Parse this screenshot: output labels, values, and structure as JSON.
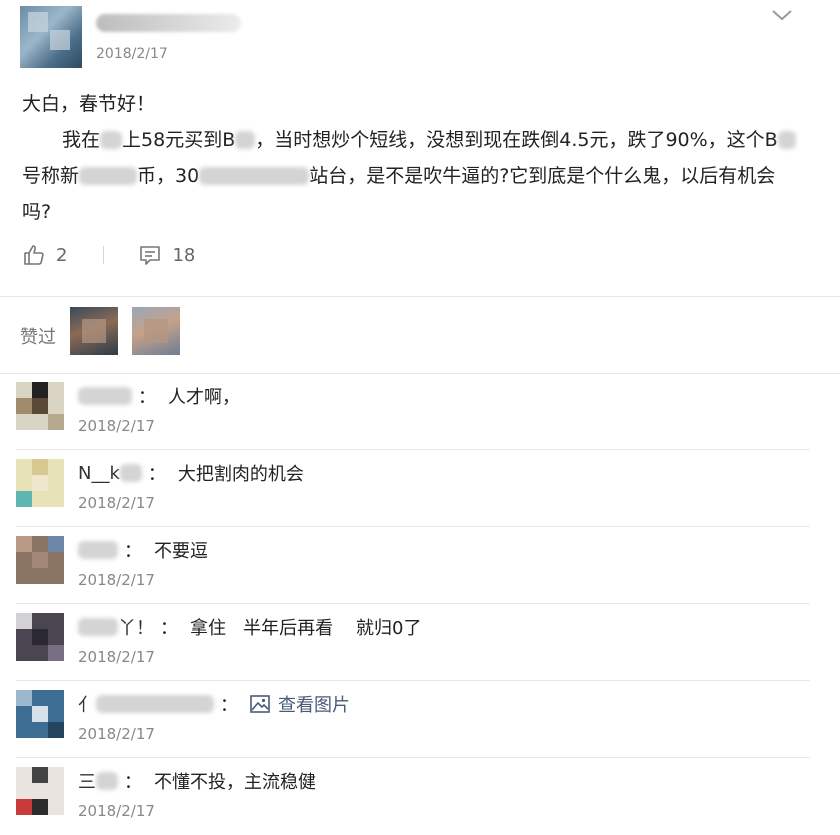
{
  "post": {
    "date": "2018/2/17",
    "greeting": "大白，春节好！",
    "body_part1": "我在",
    "body_part2": "上58元买到B",
    "body_part3": "，当时想炒个短线，没想到现在跌倒4.5元，跌了90%，这个B",
    "body_part4": "号称新",
    "body_part5": "币，30",
    "body_part6": "站台，是不是吹牛逼的?它到底是个什么鬼，以后有机会",
    "body_part7": "吗?",
    "likes_count": "2",
    "comments_count": "18"
  },
  "likes": {
    "label": "赞过"
  },
  "comments": [
    {
      "name": "",
      "text": "人才啊，",
      "date": "2018/2/17"
    },
    {
      "name": "N__k",
      "text": "大把割肉的机会",
      "date": "2018/2/17"
    },
    {
      "name": "",
      "text": "不要逗",
      "date": "2018/2/17"
    },
    {
      "name": "丫！",
      "text": "拿住   半年后再看    就归0了",
      "date": "2018/2/17"
    },
    {
      "name": "亻",
      "text": "查看图片",
      "date": "2018/2/17"
    },
    {
      "name": "三",
      "text": "不懂不投，主流稳健",
      "date": "2018/2/17"
    }
  ],
  "colors": {
    "accent": "#4a5a7a",
    "muted": "#888888"
  },
  "icons": {
    "like": "thumbs-up-icon",
    "comment": "comment-icon",
    "expand": "chevron-down-icon",
    "image": "image-icon"
  }
}
